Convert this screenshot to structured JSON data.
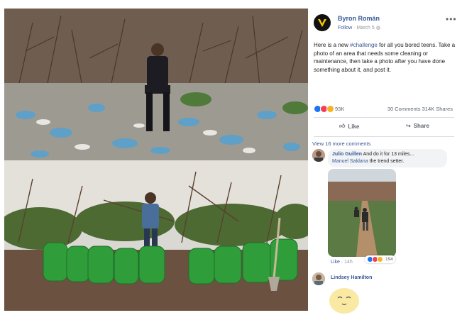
{
  "post": {
    "author": "Byron Román",
    "follow_label": "Follow",
    "date": "March 5",
    "caption_pre": "Here is a new ",
    "hashtag": "#challenge",
    "caption_post": " for all you bored teens. Take a photo of an area that needs some cleaning or maintenance, then take a photo after you have done something about it, and post it.",
    "reaction_count": "93K",
    "comments_count": "30 Comments",
    "shares_count": "314K Shares",
    "like_label": "Like",
    "share_label": "Share",
    "view_more": "View 16 more comments"
  },
  "comments": [
    {
      "name": "Julio Guillen",
      "text": "And do it for 13 miles...",
      "tag": "Manuel Saldana",
      "tag_suffix": " the trend setter.",
      "like_label": "Like",
      "time": "14h",
      "reactions": "194"
    },
    {
      "name": "Lindsey Hamilton"
    }
  ],
  "colors": {
    "link": "#385898",
    "muted": "#90949c",
    "like_blue": "#1877f2",
    "bag_green": "#2f9e3a"
  }
}
